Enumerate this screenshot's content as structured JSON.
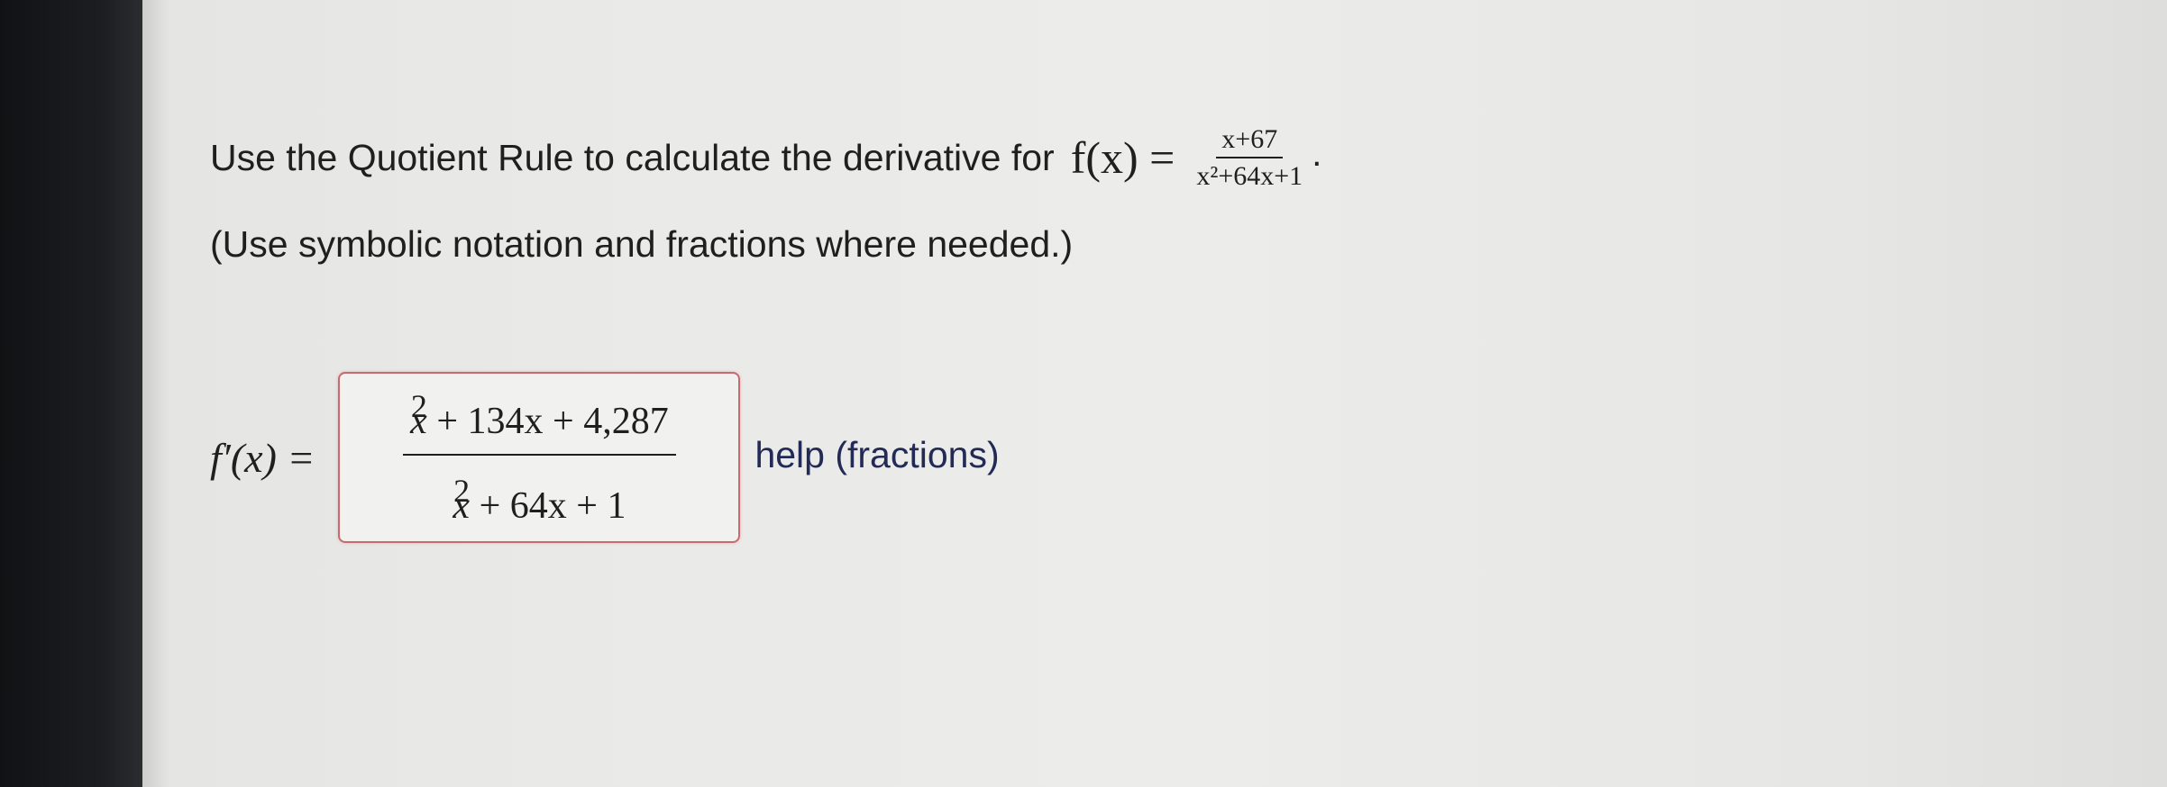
{
  "question": {
    "prompt": "Use the Quotient Rule to calculate the derivative for",
    "function_lhs": "f(x) =",
    "function_numerator": "x+67",
    "function_denominator": "x²+64x+1",
    "period": ".",
    "instruction": "(Use symbolic notation and fractions where needed.)"
  },
  "answer": {
    "label": "f′(x) =",
    "numerator": {
      "base": "x",
      "exponent": "2",
      "rest": " + 134x + 4,287"
    },
    "denominator": {
      "base": "x",
      "exponent": "2",
      "rest": " + 64x + 1"
    },
    "help_link": "help (fractions)"
  },
  "colors": {
    "answer_border": "#c96a6e",
    "link": "#222a55"
  }
}
